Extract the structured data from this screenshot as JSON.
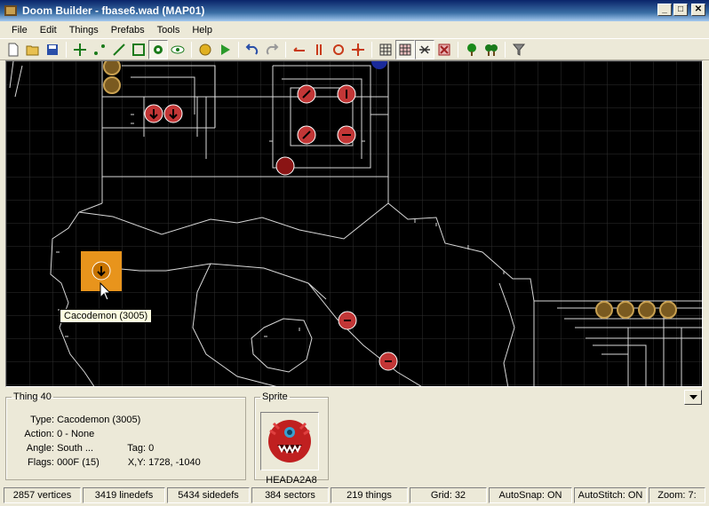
{
  "window": {
    "title": "Doom Builder - fbase6.wad (MAP01)",
    "buttons": {
      "minimize": "_",
      "maximize": "□",
      "close": "✕"
    }
  },
  "menu": [
    "File",
    "Edit",
    "Things",
    "Prefabs",
    "Tools",
    "Help"
  ],
  "toolbar": {
    "icons": [
      "new-file-icon",
      "open-folder-icon",
      "save-icon",
      "move-mode-icon",
      "vertices-mode-icon",
      "linedefs-mode-icon",
      "sectors-mode-icon",
      "things-mode-icon",
      "3d-mode-icon",
      "build-nodes-icon",
      "test-map-icon",
      "undo-icon",
      "redo-icon",
      "flip-horizontal-icon",
      "flip-vertical-icon",
      "rotate-icon",
      "scale-icon",
      "grid-icon",
      "snap-grid-icon",
      "stitch-icon",
      "delete-icon",
      "tree-icon",
      "tree-alt-icon",
      "filter-icon"
    ]
  },
  "map": {
    "tooltip": "Cacodemon (3005)",
    "colors": {
      "background": "#000000",
      "grid": "#2f2f2f",
      "lines": "#d8d8d8",
      "monster": "#c23636",
      "item": "#7a5a20",
      "selection": "#e8941c"
    }
  },
  "thing_panel": {
    "legend": "Thing 40",
    "type_label": "Type:",
    "type_value": "Cacodemon (3005)",
    "action_label": "Action:",
    "action_value": "0 - None",
    "angle_label": "Angle:",
    "angle_value": "South ...",
    "tag_label": "Tag:",
    "tag_value": "0",
    "flags_label": "Flags:",
    "flags_value": "000F (15)",
    "xy_label": "X,Y:",
    "xy_value": "1728, -1040"
  },
  "sprite_panel": {
    "legend": "Sprite",
    "name": "HEADA2A8"
  },
  "status": {
    "vertices": "2857 vertices",
    "linedefs": "3419 linedefs",
    "sidedefs": "5434 sidedefs",
    "sectors": "384 sectors",
    "things": "219 things",
    "grid": "Grid: 32",
    "autosnap": "AutoSnap: ON",
    "autostitch": "AutoStitch: ON",
    "zoom": "Zoom: 7:"
  }
}
